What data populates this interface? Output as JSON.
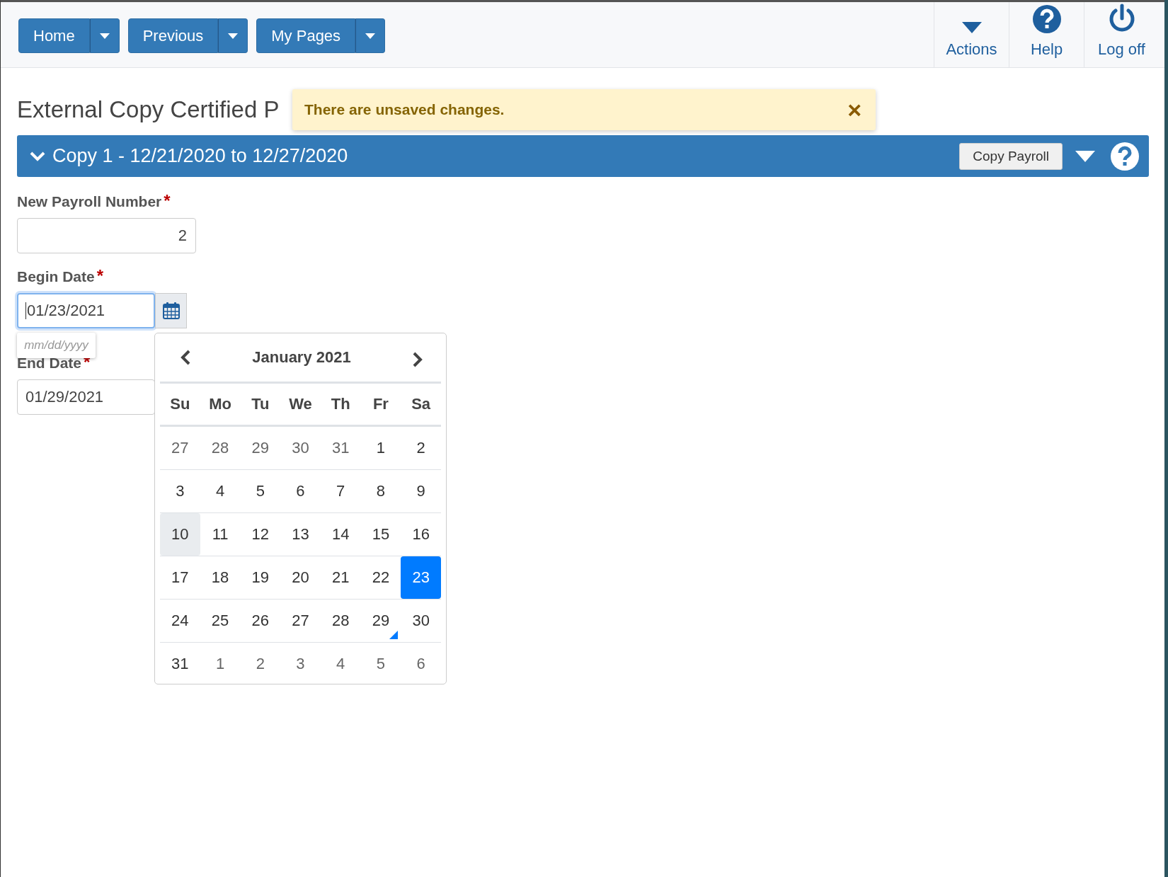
{
  "nav": {
    "menus": [
      {
        "label": "Home"
      },
      {
        "label": "Previous"
      },
      {
        "label": "My Pages"
      }
    ],
    "actions": [
      {
        "kind": "caret",
        "label": "Actions"
      },
      {
        "kind": "help",
        "label": "Help"
      },
      {
        "kind": "power",
        "label": "Log off"
      }
    ]
  },
  "page_title": "External Copy Certified P",
  "alert": {
    "message": "There are unsaved changes.",
    "close": "×"
  },
  "section": {
    "title": "Copy 1 - 12/21/2020 to 12/27/2020",
    "expanded": true,
    "button": "Copy Payroll"
  },
  "fields": [
    {
      "label": "New Payroll Number",
      "required": "*",
      "value": "2",
      "kind": "number"
    },
    {
      "label": "Begin Date",
      "required": "*",
      "value": "01/23/2021",
      "kind": "date",
      "focused": true,
      "hint": "mm/dd/yyyy"
    },
    {
      "label": "End Date",
      "required": "*",
      "value": "01/29/2021",
      "kind": "date",
      "focused": false
    }
  ],
  "calendar": {
    "month": "January 2021",
    "weekdays": [
      "Su",
      "Mo",
      "Tu",
      "We",
      "Th",
      "Fr",
      "Sa"
    ],
    "weeks": [
      [
        {
          "label": "27",
          "muted": true,
          "today": false,
          "selected": false,
          "marked": false
        },
        {
          "label": "28",
          "muted": true,
          "today": false,
          "selected": false,
          "marked": false
        },
        {
          "label": "29",
          "muted": true,
          "today": false,
          "selected": false,
          "marked": false
        },
        {
          "label": "30",
          "muted": true,
          "today": false,
          "selected": false,
          "marked": false
        },
        {
          "label": "31",
          "muted": true,
          "today": false,
          "selected": false,
          "marked": false
        },
        {
          "label": "1",
          "muted": false,
          "today": false,
          "selected": false,
          "marked": false
        },
        {
          "label": "2",
          "muted": false,
          "today": false,
          "selected": false,
          "marked": false
        }
      ],
      [
        {
          "label": "3",
          "muted": false,
          "today": false,
          "selected": false,
          "marked": false
        },
        {
          "label": "4",
          "muted": false,
          "today": false,
          "selected": false,
          "marked": false
        },
        {
          "label": "5",
          "muted": false,
          "today": false,
          "selected": false,
          "marked": false
        },
        {
          "label": "6",
          "muted": false,
          "today": false,
          "selected": false,
          "marked": false
        },
        {
          "label": "7",
          "muted": false,
          "today": false,
          "selected": false,
          "marked": false
        },
        {
          "label": "8",
          "muted": false,
          "today": false,
          "selected": false,
          "marked": false
        },
        {
          "label": "9",
          "muted": false,
          "today": false,
          "selected": false,
          "marked": false
        }
      ],
      [
        {
          "label": "10",
          "muted": false,
          "today": true,
          "selected": false,
          "marked": false
        },
        {
          "label": "11",
          "muted": false,
          "today": false,
          "selected": false,
          "marked": false
        },
        {
          "label": "12",
          "muted": false,
          "today": false,
          "selected": false,
          "marked": false
        },
        {
          "label": "13",
          "muted": false,
          "today": false,
          "selected": false,
          "marked": false
        },
        {
          "label": "14",
          "muted": false,
          "today": false,
          "selected": false,
          "marked": false
        },
        {
          "label": "15",
          "muted": false,
          "today": false,
          "selected": false,
          "marked": false
        },
        {
          "label": "16",
          "muted": false,
          "today": false,
          "selected": false,
          "marked": false
        }
      ],
      [
        {
          "label": "17",
          "muted": false,
          "today": false,
          "selected": false,
          "marked": false
        },
        {
          "label": "18",
          "muted": false,
          "today": false,
          "selected": false,
          "marked": false
        },
        {
          "label": "19",
          "muted": false,
          "today": false,
          "selected": false,
          "marked": false
        },
        {
          "label": "20",
          "muted": false,
          "today": false,
          "selected": false,
          "marked": false
        },
        {
          "label": "21",
          "muted": false,
          "today": false,
          "selected": false,
          "marked": false
        },
        {
          "label": "22",
          "muted": false,
          "today": false,
          "selected": false,
          "marked": false
        },
        {
          "label": "23",
          "muted": false,
          "today": false,
          "selected": true,
          "marked": false
        }
      ],
      [
        {
          "label": "24",
          "muted": false,
          "today": false,
          "selected": false,
          "marked": false
        },
        {
          "label": "25",
          "muted": false,
          "today": false,
          "selected": false,
          "marked": false
        },
        {
          "label": "26",
          "muted": false,
          "today": false,
          "selected": false,
          "marked": false
        },
        {
          "label": "27",
          "muted": false,
          "today": false,
          "selected": false,
          "marked": false
        },
        {
          "label": "28",
          "muted": false,
          "today": false,
          "selected": false,
          "marked": false
        },
        {
          "label": "29",
          "muted": false,
          "today": false,
          "selected": false,
          "marked": true
        },
        {
          "label": "30",
          "muted": false,
          "today": false,
          "selected": false,
          "marked": false
        }
      ],
      [
        {
          "label": "31",
          "muted": false,
          "today": false,
          "selected": false,
          "marked": false
        },
        {
          "label": "1",
          "muted": true,
          "today": false,
          "selected": false,
          "marked": false
        },
        {
          "label": "2",
          "muted": true,
          "today": false,
          "selected": false,
          "marked": false
        },
        {
          "label": "3",
          "muted": true,
          "today": false,
          "selected": false,
          "marked": false
        },
        {
          "label": "4",
          "muted": true,
          "today": false,
          "selected": false,
          "marked": false
        },
        {
          "label": "5",
          "muted": true,
          "today": false,
          "selected": false,
          "marked": false
        },
        {
          "label": "6",
          "muted": true,
          "today": false,
          "selected": false,
          "marked": false
        }
      ]
    ]
  }
}
